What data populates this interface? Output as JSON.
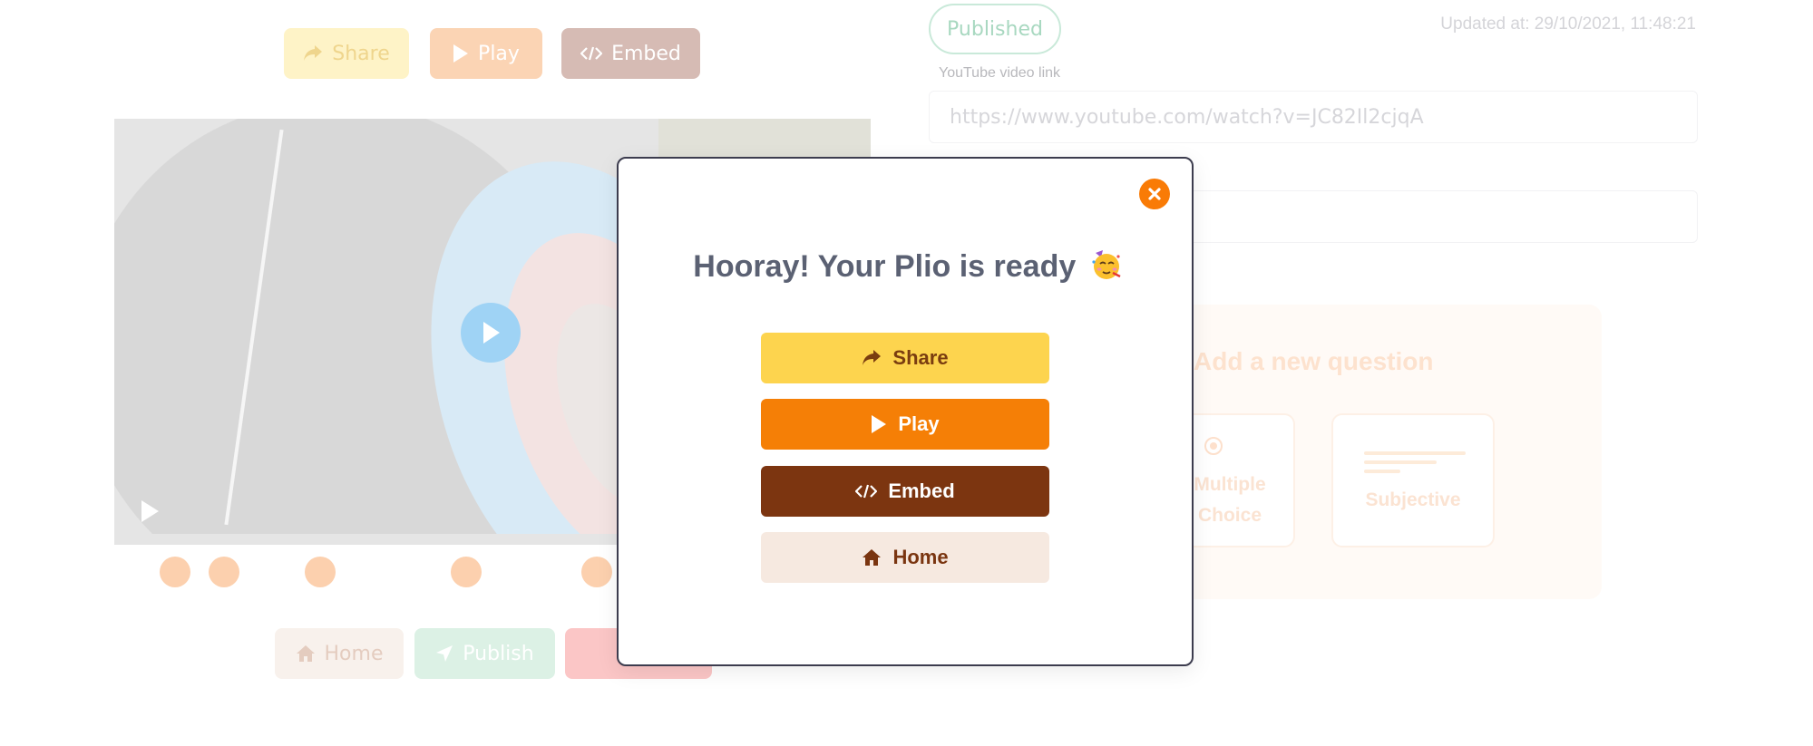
{
  "background": {
    "top_actions": {
      "share_label": "Share",
      "play_label": "Play",
      "embed_label": "Embed"
    },
    "bottom_actions": {
      "home_label": "Home",
      "publish_label": "Publish"
    },
    "status_badge": "Published",
    "updated_at": "Updated at: 29/10/2021, 11:48:21",
    "youtube": {
      "label": "YouTube video link",
      "value": "https://www.youtube.com/watch?v=JC82Il2cjqA"
    },
    "question_panel": {
      "title": "Add a new question",
      "mcq_label": "Multiple Choice",
      "subjective_label": "Subjective"
    }
  },
  "modal": {
    "title": "Hooray! Your Plio is ready",
    "emoji": "partying-face",
    "share_label": "Share",
    "play_label": "Play",
    "embed_label": "Embed",
    "home_label": "Home"
  },
  "colors": {
    "share": "#fdd44e",
    "play": "#f57f06",
    "embed": "#7c3510",
    "home": "#f6e9e0",
    "close": "#f97b06"
  }
}
